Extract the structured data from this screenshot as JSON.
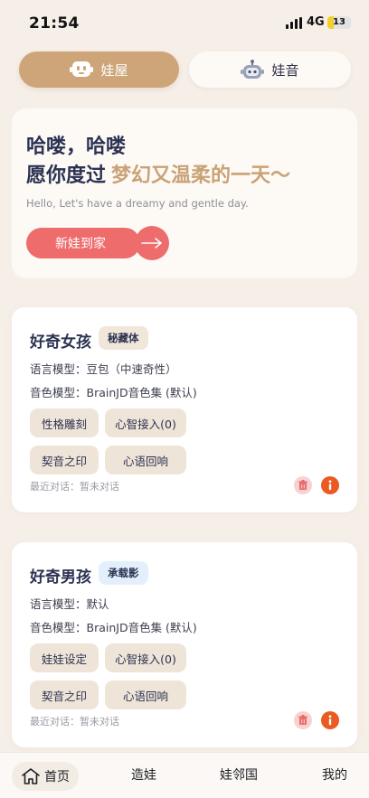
{
  "status_bar": {
    "time": "21:54",
    "network": "4G",
    "battery": "13",
    "battery_level_pct": 13
  },
  "top_tabs": [
    {
      "label": "娃屋",
      "active": true,
      "icon": "robot-face-icon"
    },
    {
      "label": "娃音",
      "active": false,
      "icon": "robot-head-icon"
    }
  ],
  "hero": {
    "line1": "哈喽，哈喽",
    "line2_prefix": "愿你度过",
    "line2_accent": "梦幻又温柔的一天～",
    "subtitle": "Hello, Let's have a dreamy and gentle day.",
    "cta_label": "新娃到家",
    "cta_icon": "arrow-right-icon"
  },
  "cards": [
    {
      "name": "好奇女孩",
      "badge": "秘藏体",
      "lang_model": "语言模型：豆包（中速奇性）",
      "voice_model": "音色模型：BrainJD音色集 (默认)",
      "buttons": [
        "性格雕刻",
        "心智接入(0)",
        "契音之印",
        "心语回响"
      ],
      "last_chat": "最近对话：暂未对话"
    },
    {
      "name": "好奇男孩",
      "badge": "承载影",
      "lang_model": "语言模型：默认",
      "voice_model": "音色模型：BrainJD音色集 (默认)",
      "buttons": [
        "娃娃设定",
        "心智接入(0)",
        "契音之印",
        "心语回响"
      ],
      "last_chat": "最近对话：暂未对话"
    }
  ],
  "bottom_nav": [
    {
      "label": "首页",
      "active": true,
      "icon": "home-icon"
    },
    {
      "label": "造娃",
      "active": false
    },
    {
      "label": "娃邻国",
      "active": false
    },
    {
      "label": "我的",
      "active": false
    }
  ],
  "colors": {
    "accent_gold": "#cda578",
    "cta_red": "#ee6c6c",
    "info_orange": "#ea5a21",
    "background": "#f6efe8"
  }
}
